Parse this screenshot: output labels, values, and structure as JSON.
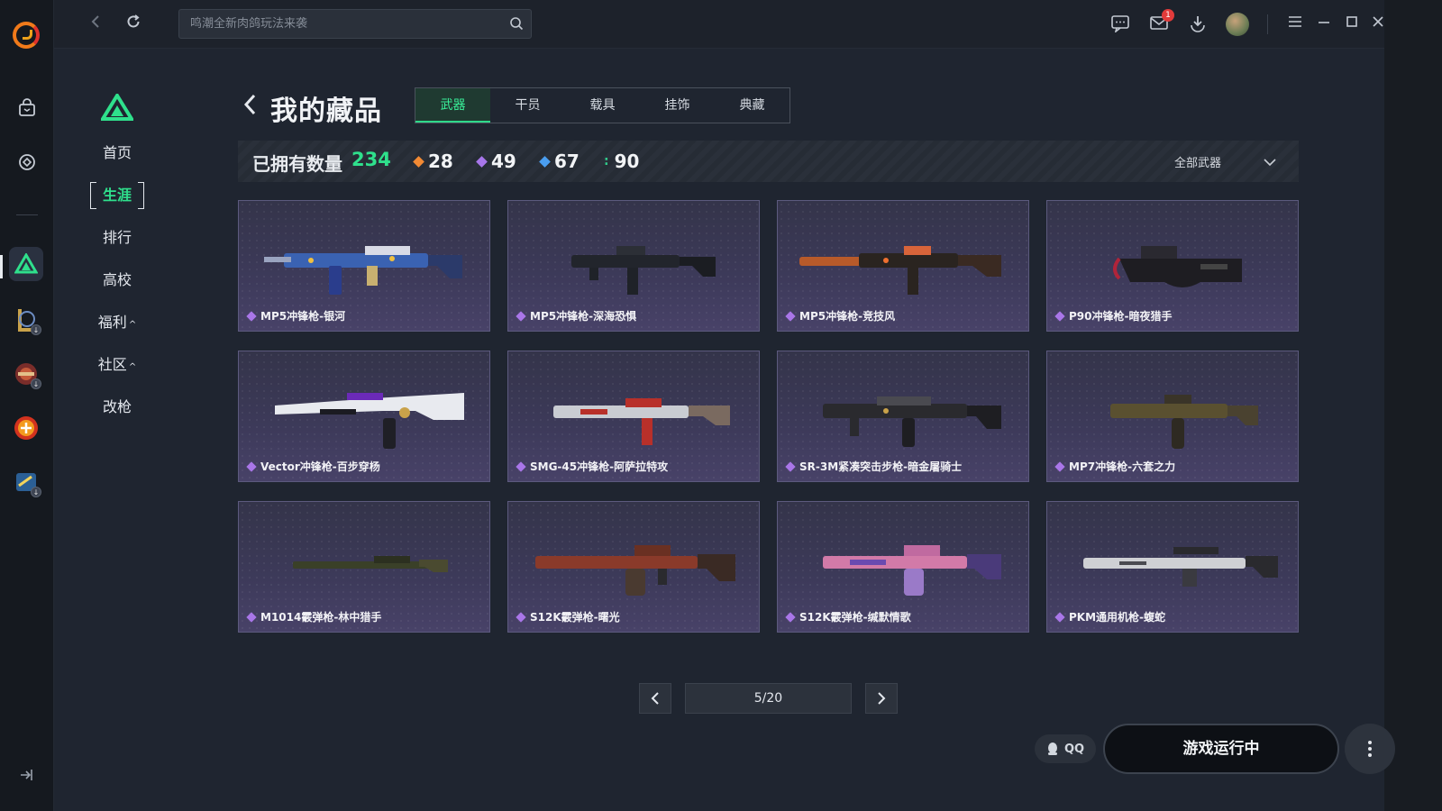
{
  "topbar": {
    "search_placeholder": "鸣潮全新肉鸽玩法来袭",
    "mail_count": "1",
    "icons": [
      "chat-icon",
      "mail-icon",
      "download-icon",
      "menu-icon",
      "minimize-icon",
      "maximize-icon",
      "close-icon"
    ]
  },
  "rail": {
    "items": [
      "bag-icon",
      "game-tag-icon",
      "delta-game",
      "lol-game",
      "game-3",
      "cf-game",
      "game-5"
    ]
  },
  "subnav": {
    "items": [
      {
        "label": "首页"
      },
      {
        "label": "生涯"
      },
      {
        "label": "排行"
      },
      {
        "label": "高校"
      },
      {
        "label": "福利",
        "caret": "^"
      },
      {
        "label": "社区",
        "caret": "^"
      },
      {
        "label": "改枪"
      }
    ],
    "active_index": 1
  },
  "main": {
    "title": "我的藏品",
    "tabs": [
      "武器",
      "干员",
      "载具",
      "挂饰",
      "典藏"
    ],
    "active_tab": 0
  },
  "stats": {
    "label": "已拥有数量",
    "total": "234",
    "rarities": [
      {
        "count": "28",
        "color": "#f28a34"
      },
      {
        "count": "49",
        "color": "#a776ea"
      },
      {
        "count": "67",
        "color": "#4a9ef0"
      },
      {
        "count": "90",
        "color": "#31c98a"
      }
    ],
    "filter_label": "全部武器"
  },
  "items": [
    {
      "name": "MP5冲锋枪-银河"
    },
    {
      "name": "MP5冲锋枪-深海恐惧"
    },
    {
      "name": "MP5冲锋枪-竞技风"
    },
    {
      "name": "P90冲锋枪-暗夜猎手"
    },
    {
      "name": "Vector冲锋枪-百步穿杨"
    },
    {
      "name": "SMG-45冲锋枪-阿萨拉特攻"
    },
    {
      "name": "SR-3M紧凑突击步枪-暗金屠骑士"
    },
    {
      "name": "MP7冲锋枪-六套之力"
    },
    {
      "name": "M1014霰弹枪-林中猎手"
    },
    {
      "name": "S12K霰弹枪-曙光"
    },
    {
      "name": "S12K霰弹枪-缄默情歌"
    },
    {
      "name": "PKM通用机枪-蝮蛇"
    }
  ],
  "pager": {
    "page": "5/20"
  },
  "footer": {
    "qq_label": "QQ",
    "run_label": "游戏运行中"
  }
}
